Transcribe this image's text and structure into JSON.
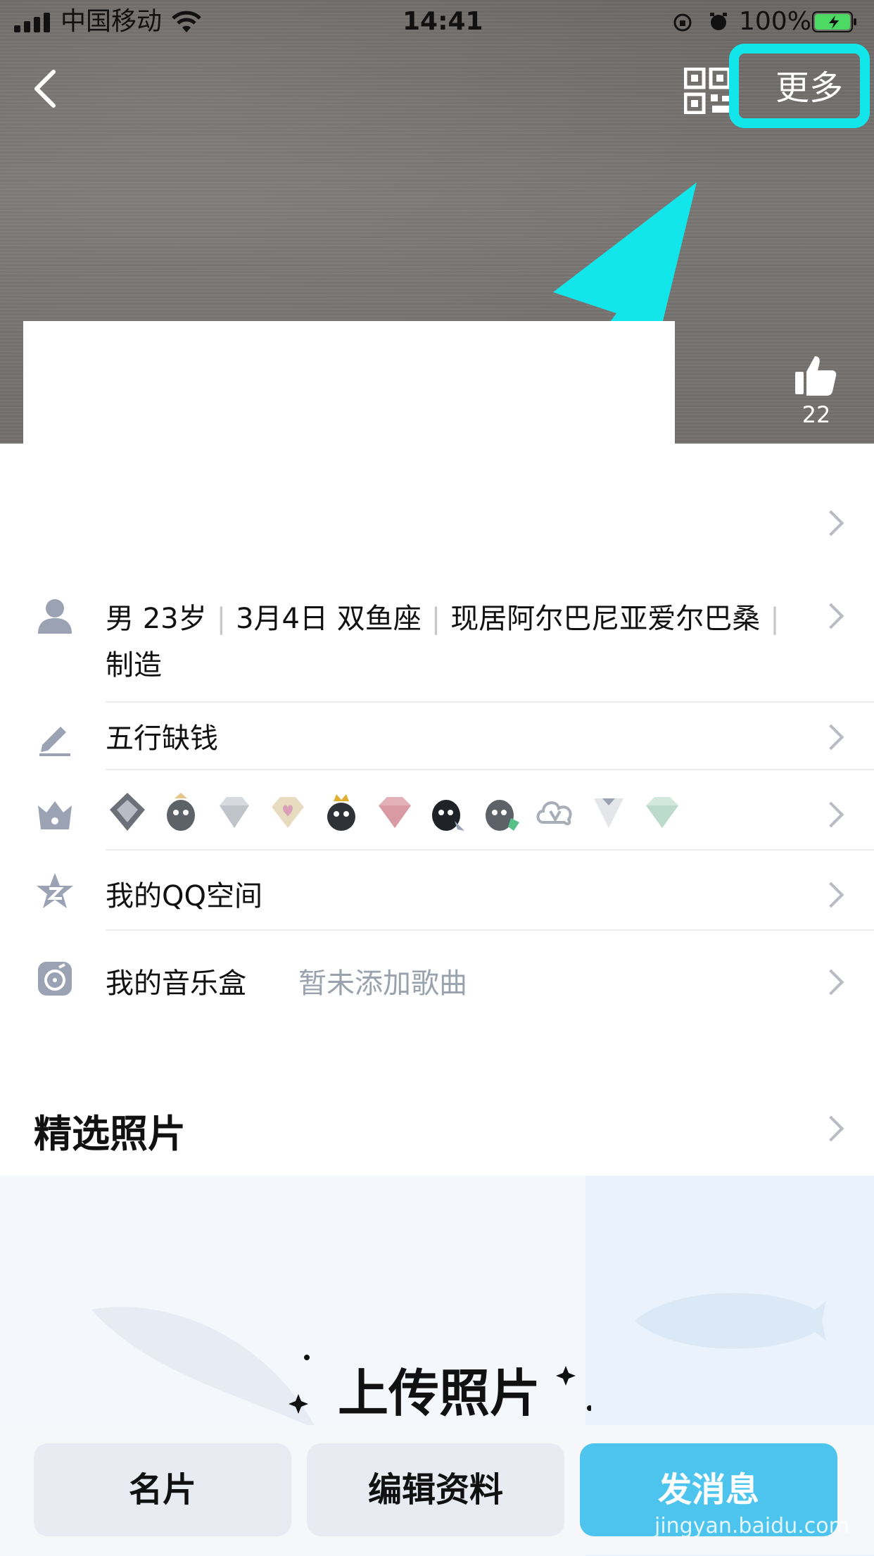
{
  "status_bar": {
    "carrier": "中国移动",
    "time": "14:41",
    "battery": "100%"
  },
  "header": {
    "more_label": "更多",
    "like_count": "22"
  },
  "profile_rows": {
    "basic_info": {
      "gender_age": "男 23岁",
      "birthday": "3月4日 双鱼座",
      "location": "现居阿尔巴尼亚爱尔巴桑",
      "occupation": "制造"
    },
    "signature": "五行缺钱",
    "qzone": "我的QQ空间",
    "music_box": {
      "label": "我的音乐盒",
      "hint": "暂未添加歌曲"
    }
  },
  "photos": {
    "section_title": "精选照片",
    "upload_title": "上传照片"
  },
  "bottom_bar": {
    "card_label": "名片",
    "edit_label": "编辑资料",
    "message_label": "发消息"
  },
  "watermark": "jingyan.baidu.com",
  "colors": {
    "highlight": "#12e6ea",
    "primary_button": "#4cc4ee",
    "secondary_button": "#e8ebf1"
  }
}
